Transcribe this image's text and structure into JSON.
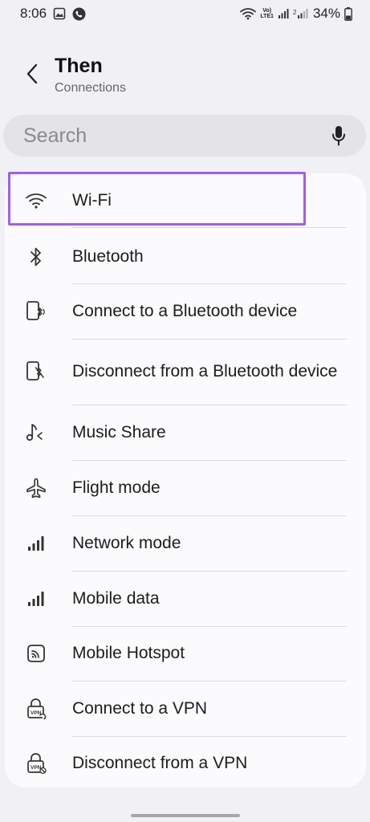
{
  "status_bar": {
    "time": "8:06",
    "network_label_top": "Vo)",
    "network_label_bottom": "LTE1",
    "battery": "34%"
  },
  "header": {
    "title": "Then",
    "subtitle": "Connections"
  },
  "search": {
    "placeholder": "Search"
  },
  "items": [
    {
      "label": "Wi-Fi",
      "icon": "wifi-icon"
    },
    {
      "label": "Bluetooth",
      "icon": "bluetooth-icon"
    },
    {
      "label": "Connect to a Bluetooth device",
      "icon": "bluetooth-device-icon"
    },
    {
      "label": "Disconnect from a Bluetooth device",
      "icon": "bluetooth-disconnect-icon"
    },
    {
      "label": "Music Share",
      "icon": "music-share-icon"
    },
    {
      "label": "Flight mode",
      "icon": "airplane-icon"
    },
    {
      "label": "Network mode",
      "icon": "signal-bars-icon"
    },
    {
      "label": "Mobile data",
      "icon": "signal-bars-icon"
    },
    {
      "label": "Mobile Hotspot",
      "icon": "hotspot-icon"
    },
    {
      "label": "Connect to a VPN",
      "icon": "vpn-lock-icon"
    },
    {
      "label": "Disconnect from a VPN",
      "icon": "vpn-disconnect-icon"
    }
  ],
  "colors": {
    "highlight": "#a35cf0",
    "background": "#f1f1f5",
    "card": "#fbfbfd"
  }
}
